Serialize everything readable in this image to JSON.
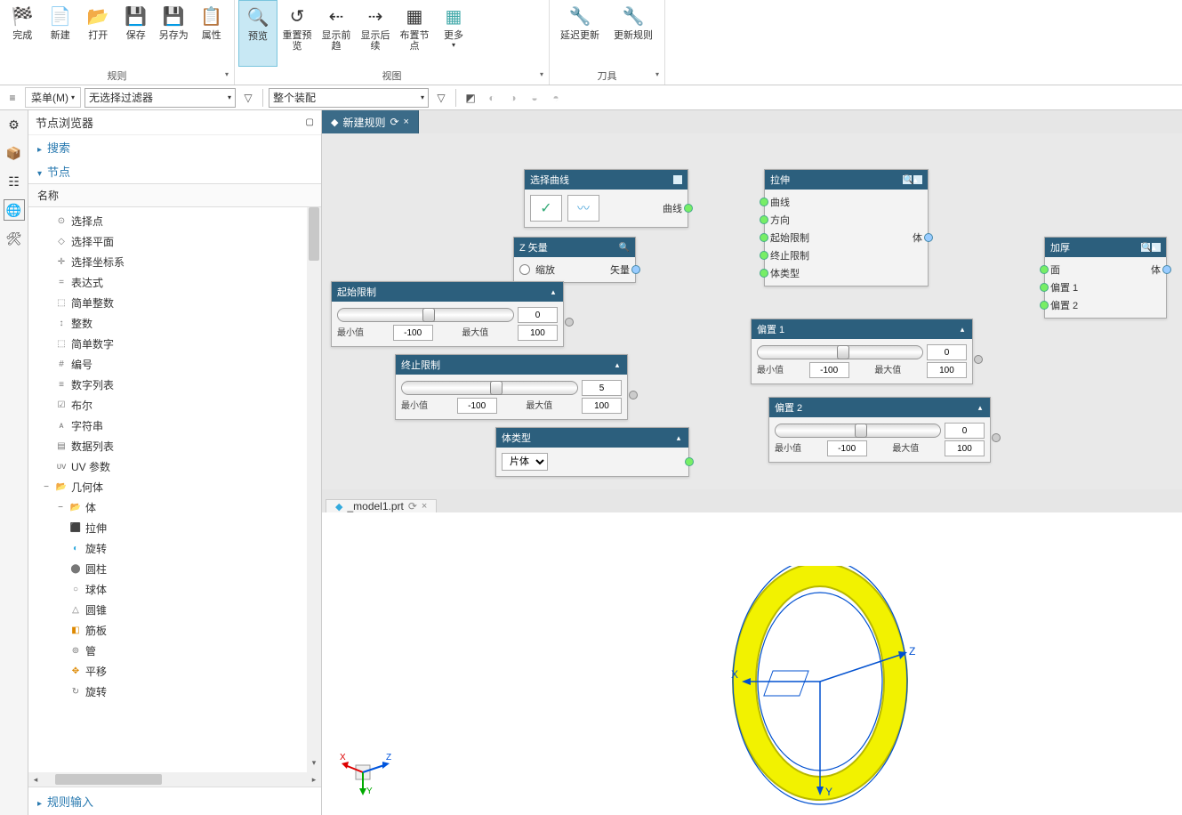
{
  "ribbon": {
    "groups": [
      {
        "label": "规则",
        "buttons": [
          {
            "id": "finish",
            "label": "完成",
            "icon": "🏁"
          },
          {
            "id": "new",
            "label": "新建",
            "icon": "📄"
          },
          {
            "id": "open",
            "label": "打开",
            "icon": "📂"
          },
          {
            "id": "save",
            "label": "保存",
            "icon": "💾"
          },
          {
            "id": "saveas",
            "label": "另存为",
            "icon": "💾"
          },
          {
            "id": "props",
            "label": "属性",
            "icon": "📋"
          }
        ]
      },
      {
        "label": "视图",
        "buttons": [
          {
            "id": "preview",
            "label": "预览",
            "icon": "🔍",
            "active": true
          },
          {
            "id": "reset-preview",
            "label": "重置预览",
            "icon": "↺"
          },
          {
            "id": "show-pred",
            "label": "显示前趋",
            "icon": "↔"
          },
          {
            "id": "show-succ",
            "label": "显示后续",
            "icon": "↔"
          },
          {
            "id": "layout-nodes",
            "label": "布置节点",
            "icon": "▦"
          },
          {
            "id": "more",
            "label": "更多",
            "icon": "⋮"
          }
        ]
      },
      {
        "label": "刀具",
        "buttons": [
          {
            "id": "delay-update",
            "label": "延迟更新",
            "icon": "⚙"
          },
          {
            "id": "update-rules",
            "label": "更新规则",
            "icon": "⚙"
          }
        ]
      }
    ]
  },
  "subbar": {
    "menu": "菜单(M)",
    "filter": "无选择过滤器",
    "assembly": "整个装配"
  },
  "panel": {
    "title": "节点浏览器",
    "search": "搜索",
    "nodes_section": "节点",
    "column": "名称",
    "footer": "规则输入",
    "items_flat": [
      "选择点",
      "选择平面",
      "选择坐标系",
      "表达式",
      "简单整数",
      "整数",
      "简单数字",
      "编号",
      "数字列表",
      "布尔",
      "字符串",
      "数据列表",
      "UV 参数"
    ],
    "geom": "几何体",
    "body": "体",
    "body_items": [
      "拉伸",
      "旋转",
      "圆柱",
      "球体",
      "圆锥",
      "筋板",
      "管",
      "平移",
      "旋转"
    ]
  },
  "tabs": {
    "rules_tab": "新建规则",
    "model_tab": "_model1.prt"
  },
  "nodes": {
    "select_curve": {
      "title": "选择曲线",
      "out": "曲线"
    },
    "z_vector": {
      "title": "Z 矢量",
      "scale": "缩放",
      "out": "矢量"
    },
    "start_limit": {
      "title": "起始限制",
      "min": "最小值",
      "max": "最大值",
      "val": "0",
      "minv": "-100",
      "maxv": "100"
    },
    "end_limit": {
      "title": "终止限制",
      "min": "最小值",
      "max": "最大值",
      "val": "5",
      "minv": "-100",
      "maxv": "100"
    },
    "body_type": {
      "title": "体类型",
      "option": "片体"
    },
    "extrude": {
      "title": "拉伸",
      "ins": [
        "曲线",
        "方向",
        "起始限制",
        "终止限制",
        "体类型"
      ],
      "out": "体"
    },
    "offset1": {
      "title": "偏置 1",
      "min": "最小值",
      "max": "最大值",
      "val": "0",
      "minv": "-100",
      "maxv": "100"
    },
    "offset2": {
      "title": "偏置 2",
      "min": "最小值",
      "max": "最大值",
      "val": "0",
      "minv": "-100",
      "maxv": "100"
    },
    "thicken": {
      "title": "加厚",
      "ins": [
        "面",
        "偏置 1",
        "偏置 2"
      ],
      "out": "体"
    }
  }
}
